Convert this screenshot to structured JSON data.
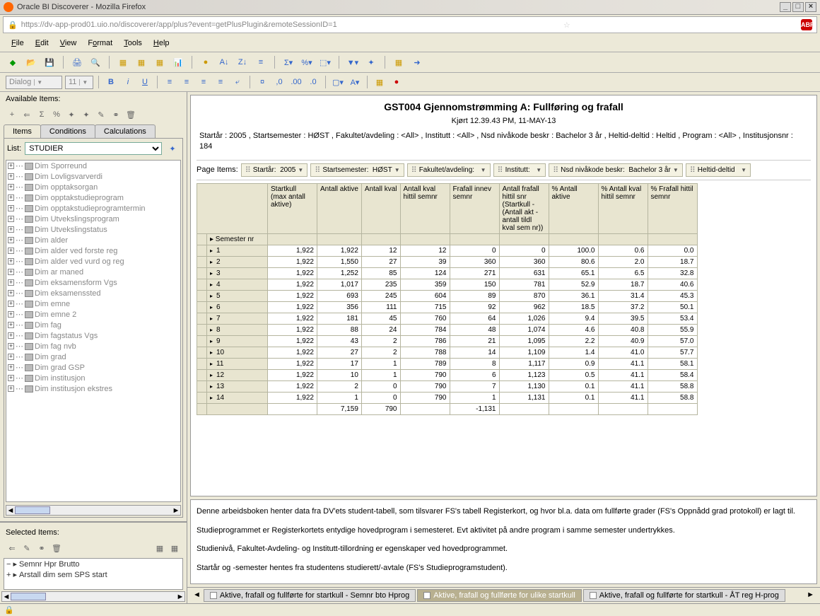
{
  "window": {
    "title": "Oracle BI Discoverer - Mozilla Firefox"
  },
  "url": "https://dv-app-prod01.uio.no/discoverer/app/plus?event=getPlusPlugin&remoteSessionID=1",
  "menus": [
    "File",
    "Edit",
    "View",
    "Format",
    "Tools",
    "Help"
  ],
  "format_bar": {
    "font": "Dialog",
    "size": "11"
  },
  "left": {
    "available": "Available Items:",
    "tabs": [
      "Items",
      "Conditions",
      "Calculations"
    ],
    "list_label": "List:",
    "list_value": "STUDIER",
    "tree": [
      "Dim Sporreund",
      "Dim Lovligsvarverdi",
      "Dim opptaksorgan",
      "Dim opptakstudieprogram",
      "Dim opptakstudieprogramtermin",
      "Dim Utvekslingsprogram",
      "Dim Utvekslingstatus",
      "Dim alder",
      "Dim alder ved forste reg",
      "Dim alder ved vurd og reg",
      "Dim ar maned",
      "Dim eksamensform Vgs",
      "Dim eksamenssted",
      "Dim emne",
      "Dim emne 2",
      "Dim fag",
      "Dim fagstatus Vgs",
      "Dim fag nvb",
      "Dim grad",
      "Dim grad GSP",
      "Dim institusjon",
      "Dim institusjon ekstres"
    ],
    "selected": "Selected Items:",
    "sel_items": [
      "Semnr Hpr Brutto",
      "Arstall dim sem SPS start"
    ]
  },
  "report": {
    "title": "GST004 Gjennomstrømming A: Fullføring og frafall",
    "subtitle": "Kjørt 12.39.43 PM, 11-MAY-13",
    "params": "Startår : 2005 , Startsemester : HØST , Fakultet/avdeling : <All> , Institutt : <All> , Nsd nivåkode beskr : Bachelor 3 år , Heltid-deltid : Heltid , Program : <All> , Institusjonsnr : 184",
    "page_items_label": "Page Items:",
    "page_items": [
      {
        "l": "Startår:",
        "v": "2005"
      },
      {
        "l": "Startsemester:",
        "v": "HØST"
      },
      {
        "l": "Fakultet/avdeling:",
        "v": "<All>"
      },
      {
        "l": "Institutt:",
        "v": "<All>"
      },
      {
        "l": "Nsd nivåkode beskr:",
        "v": "Bachelor 3 år"
      },
      {
        "l": "Heltid-deltid",
        "v": ""
      }
    ],
    "col_headers": [
      "Startkull (max antall aktive)",
      "Antall aktive",
      "Antall kval",
      "Antall kval hittil semnr",
      "Frafall innev semnr",
      "Antall frafall hittil snr (Startkull - (Antall akt - antall tildl kval sem nr))",
      "% Antall aktive",
      "% Antall kval hittil semnr",
      "% Frafall hittil semnr"
    ],
    "row_header": "Semester nr",
    "rows": [
      {
        "n": "1",
        "c": [
          "1,922",
          "1,922",
          "12",
          "12",
          "0",
          "0",
          "100.0",
          "0.6",
          "0.0"
        ]
      },
      {
        "n": "2",
        "c": [
          "1,922",
          "1,550",
          "27",
          "39",
          "360",
          "360",
          "80.6",
          "2.0",
          "18.7"
        ]
      },
      {
        "n": "3",
        "c": [
          "1,922",
          "1,252",
          "85",
          "124",
          "271",
          "631",
          "65.1",
          "6.5",
          "32.8"
        ]
      },
      {
        "n": "4",
        "c": [
          "1,922",
          "1,017",
          "235",
          "359",
          "150",
          "781",
          "52.9",
          "18.7",
          "40.6"
        ]
      },
      {
        "n": "5",
        "c": [
          "1,922",
          "693",
          "245",
          "604",
          "89",
          "870",
          "36.1",
          "31.4",
          "45.3"
        ]
      },
      {
        "n": "6",
        "c": [
          "1,922",
          "356",
          "111",
          "715",
          "92",
          "962",
          "18.5",
          "37.2",
          "50.1"
        ]
      },
      {
        "n": "7",
        "c": [
          "1,922",
          "181",
          "45",
          "760",
          "64",
          "1,026",
          "9.4",
          "39.5",
          "53.4"
        ]
      },
      {
        "n": "8",
        "c": [
          "1,922",
          "88",
          "24",
          "784",
          "48",
          "1,074",
          "4.6",
          "40.8",
          "55.9"
        ]
      },
      {
        "n": "9",
        "c": [
          "1,922",
          "43",
          "2",
          "786",
          "21",
          "1,095",
          "2.2",
          "40.9",
          "57.0"
        ]
      },
      {
        "n": "10",
        "c": [
          "1,922",
          "27",
          "2",
          "788",
          "14",
          "1,109",
          "1.4",
          "41.0",
          "57.7"
        ]
      },
      {
        "n": "11",
        "c": [
          "1,922",
          "17",
          "1",
          "789",
          "8",
          "1,117",
          "0.9",
          "41.1",
          "58.1"
        ]
      },
      {
        "n": "12",
        "c": [
          "1,922",
          "10",
          "1",
          "790",
          "6",
          "1,123",
          "0.5",
          "41.1",
          "58.4"
        ]
      },
      {
        "n": "13",
        "c": [
          "1,922",
          "2",
          "0",
          "790",
          "7",
          "1,130",
          "0.1",
          "41.1",
          "58.8"
        ]
      },
      {
        "n": "14",
        "c": [
          "1,922",
          "1",
          "0",
          "790",
          "1",
          "1,131",
          "0.1",
          "41.1",
          "58.8"
        ]
      }
    ],
    "totals": [
      "",
      "7,159",
      "790",
      "",
      "-1,131",
      "",
      "",
      "",
      ""
    ]
  },
  "description": [
    "Denne arbeidsboken henter data fra DV'ets student-tabell, som tilsvarer FS's tabell Registerkort, og hvor bl.a. data om fullførte grader (FS's Oppnådd grad protokoll) er lagt til.",
    "Studieprogrammet er Registerkortets entydige hovedprogram i semesteret.   Evt aktivitet på andre program i samme semester undertrykkes.",
    "Studienivå, Fakultet-Avdeling- og Institutt-tillordning er egenskaper ved hovedprogrammet.",
    "Startår og -semester hentes fra studentens studierett/-avtale (FS's Studieprogramstudent)."
  ],
  "bottom_tabs": [
    "Aktive, frafall og fullførte for startkull - Semnr bto Hprog",
    "Aktive, frafall og fullførte for ulike startkull",
    "Aktive, frafall og fullførte for startkull - ÅT reg H-prog"
  ]
}
